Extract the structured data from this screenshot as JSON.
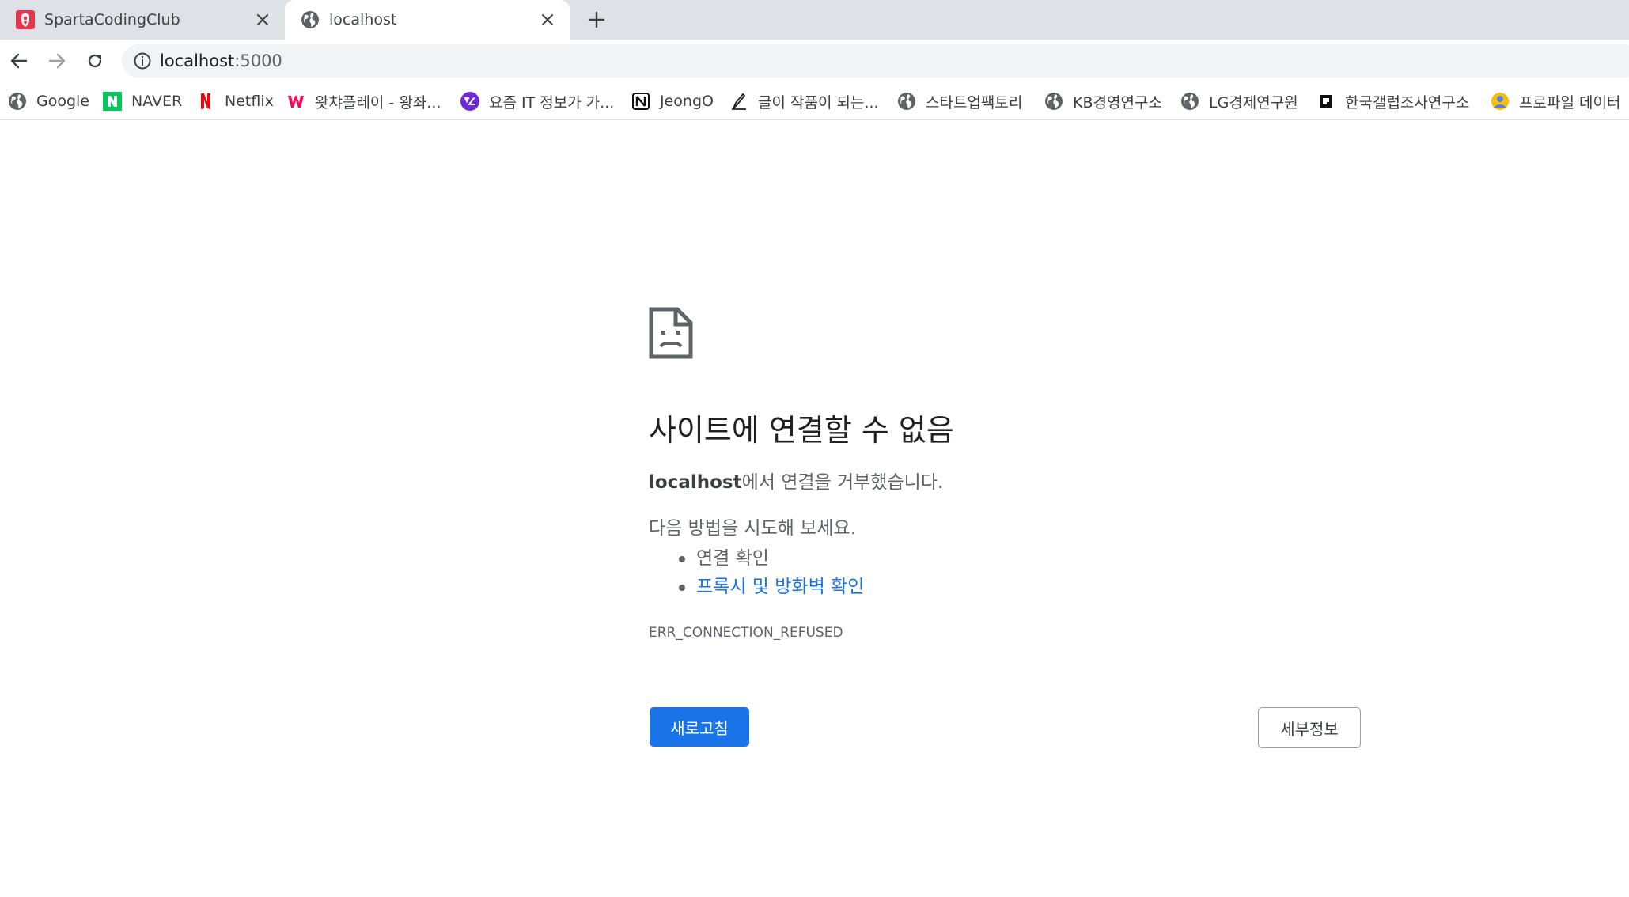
{
  "tabs": [
    {
      "title": "SpartaCodingClub",
      "favicon": "sparta-logo-icon",
      "active": false
    },
    {
      "title": "localhost",
      "favicon": "globe-icon",
      "active": true
    }
  ],
  "address_bar": {
    "host": "localhost",
    "port": ":5000",
    "icon": "info-icon"
  },
  "bookmarks": [
    {
      "label": "Google",
      "icon": "globe-icon"
    },
    {
      "label": "NAVER",
      "icon": "naver-icon"
    },
    {
      "label": "Netflix",
      "icon": "netflix-icon"
    },
    {
      "label": "왓챠플레이 - 왕좌...",
      "icon": "watcha-icon"
    },
    {
      "label": "요즘 IT 정보가 가...",
      "icon": "yozm-icon"
    },
    {
      "label": "JeongO",
      "icon": "notion-icon"
    },
    {
      "label": "글이 작품이 되는...",
      "icon": "brunch-pen-icon"
    },
    {
      "label": "스타트업팩토리",
      "icon": "globe-icon"
    },
    {
      "label": "KB경영연구소",
      "icon": "globe-icon"
    },
    {
      "label": "LG경제연구원",
      "icon": "globe-icon"
    },
    {
      "label": "한국갤럽조사연구소",
      "icon": "gallup-icon"
    },
    {
      "label": "프로파일 데이터",
      "icon": "profile-data-icon"
    }
  ],
  "error": {
    "title": "사이트에 연결할 수 없음",
    "host": "localhost",
    "description_suffix": "에서 연결을 거부했습니다.",
    "try_heading": "다음 방법을 시도해 보세요.",
    "suggestions": [
      {
        "text": "연결 확인",
        "link": false
      },
      {
        "text": "프록시 및 방화벽 확인",
        "link": true
      }
    ],
    "code": "ERR_CONNECTION_REFUSED",
    "reload_label": "새로고침",
    "details_label": "세부정보"
  },
  "colors": {
    "accent": "#1a73e8",
    "tab_strip": "#dee1e6",
    "omnibox": "#f1f3f4",
    "sparta_red": "#e8344e",
    "naver_green": "#03c75a",
    "netflix_red": "#e50914",
    "watcha_pink": "#ff0558",
    "yozm_purple": "#6d28d9"
  }
}
